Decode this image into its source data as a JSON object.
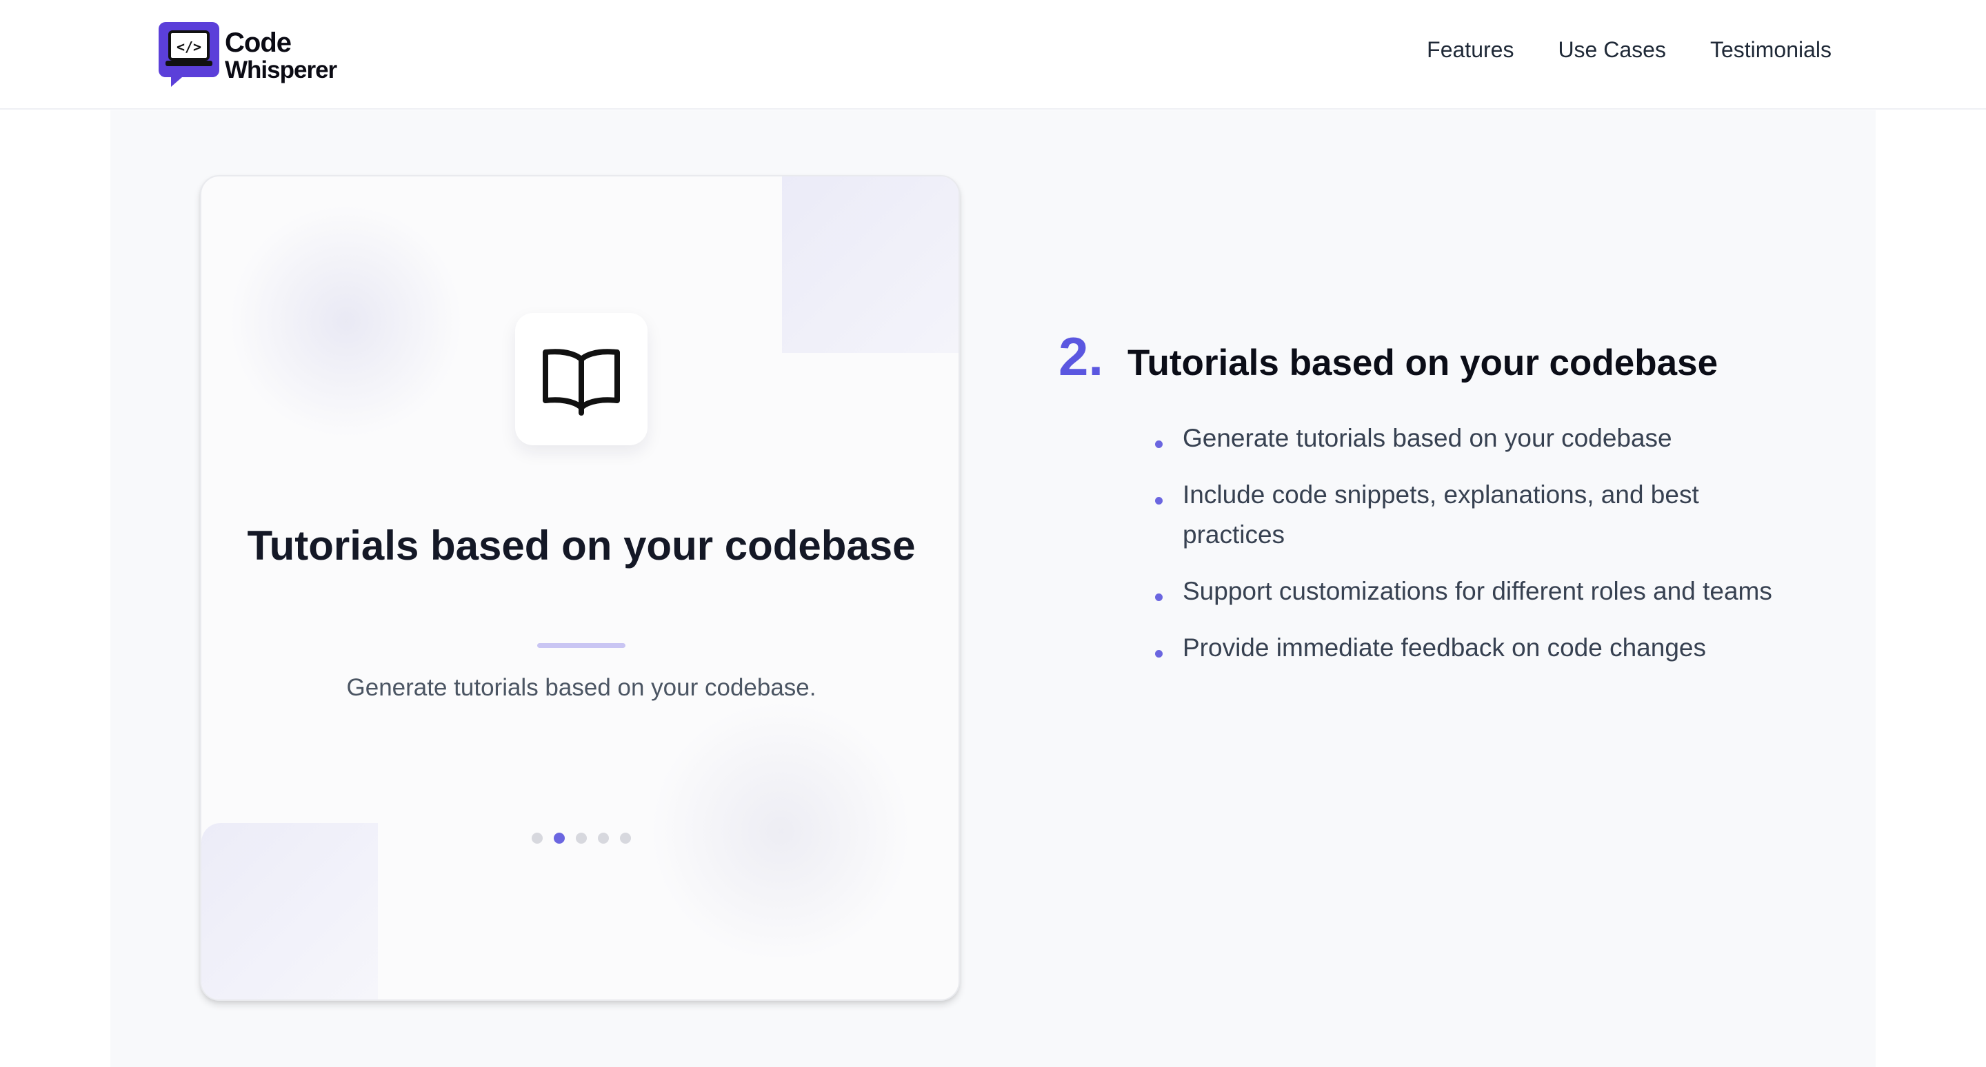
{
  "brand": {
    "name_line1": "Code",
    "name_line2": "Whisperer",
    "logo_icon": "code-laptop-chat-icon",
    "accent_color": "#5b3fd9"
  },
  "nav": {
    "items": [
      {
        "label": "Features"
      },
      {
        "label": "Use Cases"
      },
      {
        "label": "Testimonials"
      }
    ]
  },
  "card": {
    "icon": "open-book-icon",
    "title": "Tutorials based on your codebase",
    "description": "Generate tutorials based on your codebase.",
    "carousel": {
      "count": 5,
      "active_index": 1
    }
  },
  "feature": {
    "number": "2.",
    "title": "Tutorials based on your codebase",
    "bullets": [
      "Generate tutorials based on your codebase",
      "Include code snippets, explanations, and best practices",
      "Support customizations for different roles and teams",
      "Provide immediate feedback on code changes"
    ]
  },
  "colors": {
    "accent": "#5b57e0",
    "dot_inactive": "#d7d8de",
    "section_bg": "#f8f9fb"
  }
}
